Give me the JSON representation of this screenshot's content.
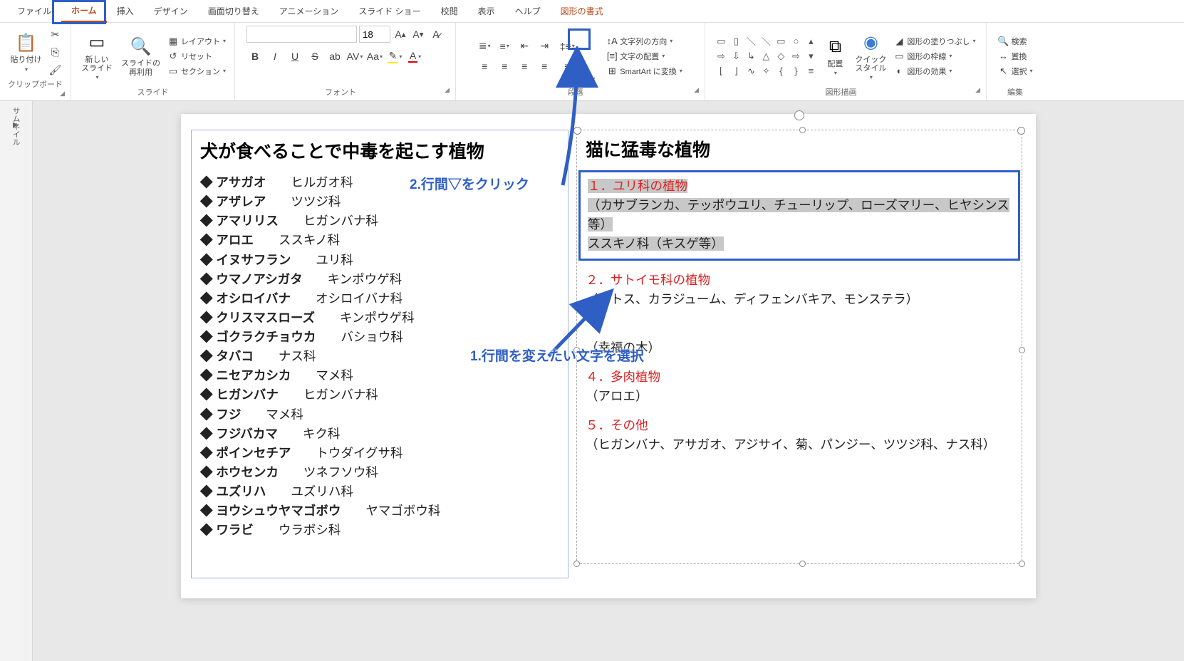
{
  "tabs": {
    "file": "ファイル",
    "home": "ホーム",
    "insert": "挿入",
    "design": "デザイン",
    "transitions": "画面切り替え",
    "animations": "アニメーション",
    "slideshow": "スライド ショー",
    "review": "校閲",
    "view": "表示",
    "help": "ヘルプ",
    "shape_format": "図形の書式"
  },
  "ribbon": {
    "clipboard": {
      "paste": "貼り付け",
      "label": "クリップボード"
    },
    "slides": {
      "new_slide": "新しい\nスライド",
      "reuse": "スライドの\n再利用",
      "layout": "レイアウト",
      "reset": "リセット",
      "section": "セクション",
      "label": "スライド"
    },
    "font": {
      "size": "18",
      "label": "フォント"
    },
    "paragraph": {
      "text_direction": "文字列の方向",
      "align_text": "文字の配置",
      "smartart": "SmartArt に変換",
      "label": "段落"
    },
    "drawing": {
      "arrange": "配置",
      "quick_styles": "クイック\nスタイル",
      "shape_fill": "図形の塗りつぶし",
      "shape_outline": "図形の枠線",
      "shape_effects": "図形の効果",
      "label": "図形描画"
    },
    "editing": {
      "find": "検索",
      "replace": "置換",
      "select": "選択",
      "label": "編集"
    }
  },
  "thumbnail_label": "サムネイル",
  "left_box": {
    "title": "犬が食べることで中毒を起こす植物",
    "plants": [
      {
        "name": "アサガオ",
        "family": "ヒルガオ科"
      },
      {
        "name": "アザレア",
        "family": "ツツジ科"
      },
      {
        "name": "アマリリス",
        "family": "ヒガンバナ科"
      },
      {
        "name": "アロエ",
        "family": "ススキノ科"
      },
      {
        "name": "イヌサフラン",
        "family": "ユリ科"
      },
      {
        "name": "ウマノアシガタ",
        "family": "キンポウゲ科"
      },
      {
        "name": "オシロイバナ",
        "family": "オシロイバナ科"
      },
      {
        "name": "クリスマスローズ",
        "family": "キンポウゲ科"
      },
      {
        "name": "ゴクラクチョウカ",
        "family": "バショウ科"
      },
      {
        "name": "タバコ",
        "family": "ナス科"
      },
      {
        "name": "ニセアカシカ",
        "family": "マメ科"
      },
      {
        "name": "ヒガンバナ",
        "family": "ヒガンバナ科"
      },
      {
        "name": "フジ",
        "family": "マメ科"
      },
      {
        "name": "フジバカマ",
        "family": "キク科"
      },
      {
        "name": "ポインセチア",
        "family": "トウダイグサ科"
      },
      {
        "name": "ホウセンカ",
        "family": "ツネフソウ科"
      },
      {
        "name": "ユズリハ",
        "family": "ユズリハ科"
      },
      {
        "name": "ヨウシュウヤマゴボウ",
        "family": "ヤマゴボウ科"
      },
      {
        "name": "ワラビ",
        "family": "ウラボシ科"
      }
    ]
  },
  "right_box": {
    "title": "猫に猛毒な植物",
    "cat1_title": "１．ユリ科の植物",
    "cat1_body1": "（カサブランカ、テッポウユリ、チューリップ、ローズマリー、ヒヤシンス等）",
    "cat1_body2": "ススキノ科（キスゲ等）",
    "cat2_title": "２．サトイモ科の植物",
    "cat2_body": "（ポトス、カラジューム、ディフェンバキア、モンステラ）",
    "cat3_body": "（幸福の木）",
    "cat4_title": "４．多肉植物",
    "cat4_body": "（アロエ）",
    "cat5_title": "５．その他",
    "cat5_body": "（ヒガンバナ、アサガオ、アジサイ、菊、パンジー、ツツジ科、ナス科）"
  },
  "annotations": {
    "step1": "1.行間を変えたい文字を選択",
    "step2": "2.行間▽をクリック"
  }
}
